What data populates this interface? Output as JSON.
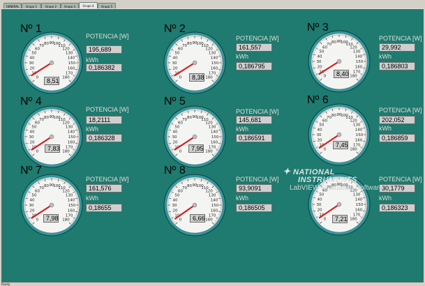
{
  "tabs": [
    {
      "label": "GENERAL",
      "active": false
    },
    {
      "label": "Grupo 1",
      "active": false
    },
    {
      "label": "Grupo 2",
      "active": false
    },
    {
      "label": "Grupo 3",
      "active": false
    },
    {
      "label": "Grupo 4",
      "active": true
    },
    {
      "label": "Grupo 5",
      "active": false
    }
  ],
  "colors": {
    "panel": "#1f7a6f",
    "needle": "#d41f1f",
    "gauge_ring": "#2e9aa0"
  },
  "gauge_scale": {
    "min": 0,
    "max": 180,
    "ticks": [
      10,
      20,
      30,
      40,
      50,
      60,
      70,
      80,
      90,
      100,
      110,
      120,
      130,
      140,
      150,
      160,
      170,
      180
    ],
    "start_label": "0"
  },
  "labels": {
    "power": "POTENCIA [W]",
    "energy": "kWh"
  },
  "meters": [
    {
      "title": "Nº 1",
      "gauge": "8,51",
      "potencia": "195,689",
      "kwh": "0,186382"
    },
    {
      "title": "Nº 2",
      "gauge": "8,38",
      "potencia": "161,557",
      "kwh": "0,186795"
    },
    {
      "title": "Nº 3",
      "gauge": "8,40",
      "potencia": "29,992",
      "kwh": "0,186803"
    },
    {
      "title": "Nº 4",
      "gauge": "7,83",
      "potencia": "18,2111",
      "kwh": "0,186328"
    },
    {
      "title": "Nº 5",
      "gauge": "7,95",
      "potencia": "145,681",
      "kwh": "0,186591"
    },
    {
      "title": "Nº 6",
      "gauge": "7,45",
      "potencia": "202,052",
      "kwh": "0,186859"
    },
    {
      "title": "Nº 7",
      "gauge": "7,98",
      "potencia": "161,576",
      "kwh": "0,18655"
    },
    {
      "title": "Nº 8",
      "gauge": "6,66",
      "potencia": "93,9091",
      "kwh": "0,186505"
    },
    {
      "title": "",
      "gauge": "7,21",
      "potencia": "30,1779",
      "kwh": "0,186323"
    }
  ],
  "watermark": {
    "line1": "NATIONAL",
    "line2": "INSTRUMENTS",
    "line3": "LabVIEW Evaluation Software"
  },
  "status_text": "Ready"
}
